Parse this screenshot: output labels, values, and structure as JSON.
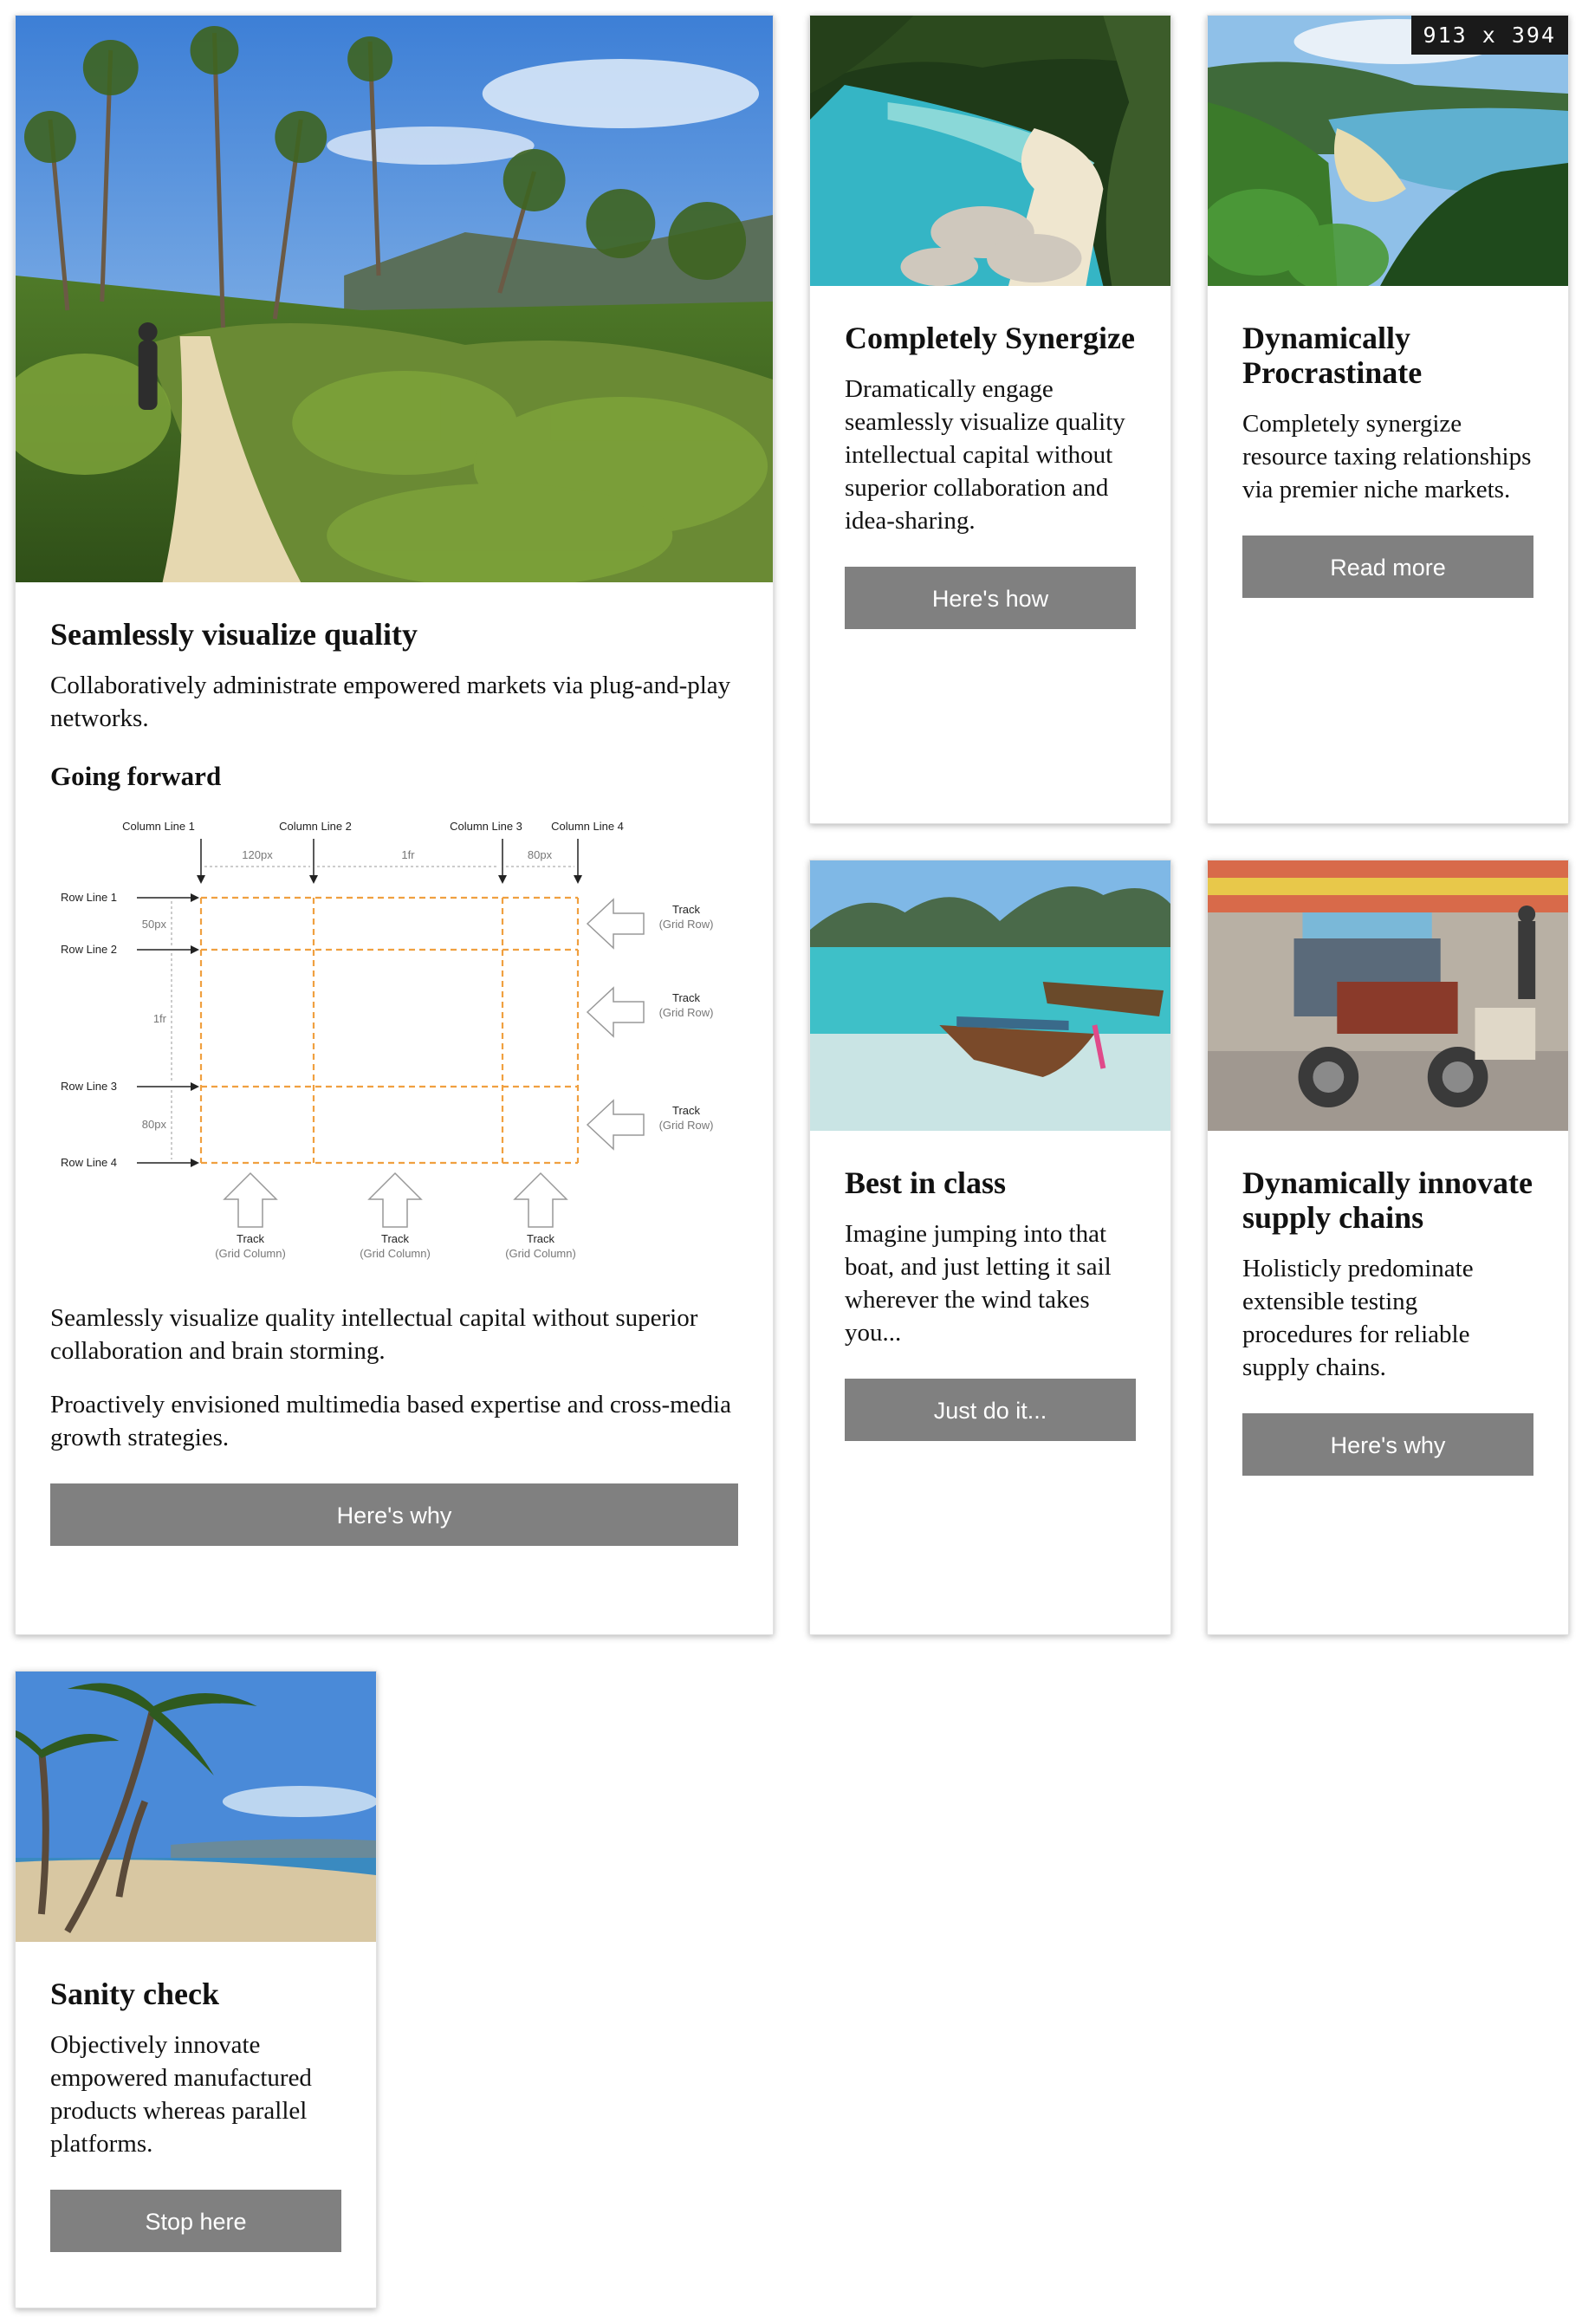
{
  "cards": {
    "main": {
      "title": "Seamlessly visualize quality",
      "intro": "Collaboratively administrate empowered markets via plug-and-play networks.",
      "subheading": "Going forward",
      "para1": "Seamlessly visualize quality intellectual capital without superior collaboration and brain storming.",
      "para2": "Proactively envisioned multimedia based expertise and cross-media growth strategies.",
      "button": "Here's why",
      "diagram": {
        "column_lines": [
          "Column Line 1",
          "Column Line 2",
          "Column Line 3",
          "Column Line 4"
        ],
        "column_sizes": [
          "120px",
          "1fr",
          "80px"
        ],
        "row_lines": [
          "Row Line 1",
          "Row Line 2",
          "Row Line 3",
          "Row Line 4"
        ],
        "row_sizes": [
          "50px",
          "1fr",
          "80px"
        ],
        "track_label": "Track",
        "grid_row_label": "(Grid Row)",
        "grid_column_label": "(Grid Column)"
      }
    },
    "synergize": {
      "title": "Completely Synergize",
      "text": "Dramatically engage seamlessly visualize quality intellectual capital without superior collaboration and idea-sharing.",
      "button": "Here's how"
    },
    "procrastinate": {
      "badge": "913 x 394",
      "title": "Dynamically Procrastinate",
      "text": "Completely synergize resource taxing relationships via premier niche markets.",
      "button": "Read more"
    },
    "best": {
      "title": "Best in class",
      "text": "Imagine jumping into that boat, and just letting it sail wherever the wind takes you...",
      "button": "Just do it..."
    },
    "supply": {
      "title": "Dynamically innovate supply chains",
      "text": "Holisticly predominate extensible testing procedures for reliable supply chains.",
      "button": "Here's why"
    },
    "sanity": {
      "title": "Sanity check",
      "text": "Objectively innovate empowered manufactured products whereas parallel platforms.",
      "button": "Stop here"
    }
  }
}
